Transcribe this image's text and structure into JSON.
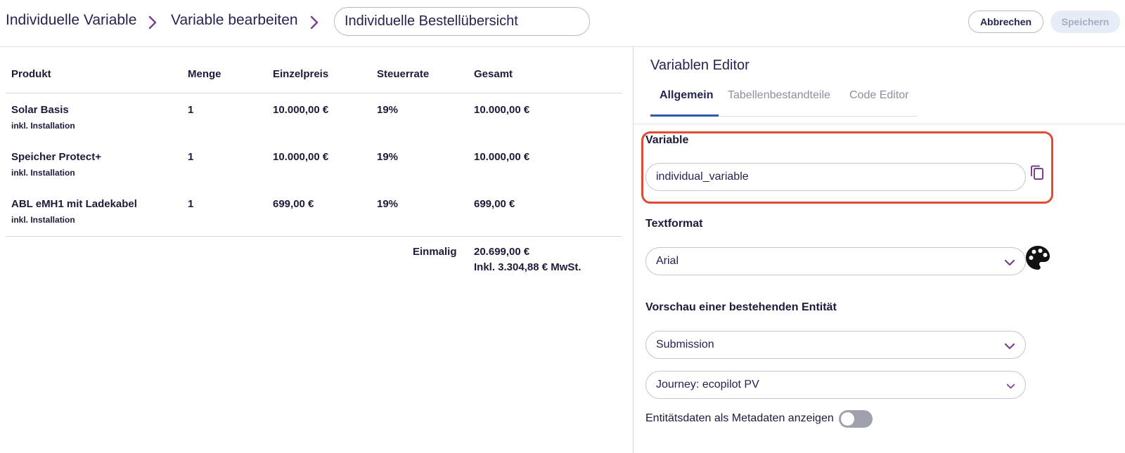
{
  "header": {
    "breadcrumb_1": "Individuelle Variable",
    "breadcrumb_2": "Variable bearbeiten",
    "name_value": "Individuelle Bestellübersicht",
    "cancel_label": "Abbrechen",
    "save_label": "Speichern"
  },
  "table": {
    "headers": [
      "Produkt",
      "Menge",
      "Einzelpreis",
      "Steuerrate",
      "Gesamt"
    ],
    "rows": [
      {
        "product": "Solar Basis",
        "note": "inkl. Installation",
        "qty": "1",
        "unit_price": "10.000,00 €",
        "tax": "19%",
        "total": "10.000,00 €"
      },
      {
        "product": "Speicher Protect+",
        "note": "inkl. Installation",
        "qty": "1",
        "unit_price": "10.000,00 €",
        "tax": "19%",
        "total": "10.000,00 €"
      },
      {
        "product": "ABL eMH1 mit Ladekabel",
        "note": "inkl. Installation",
        "qty": "1",
        "unit_price": "699,00 €",
        "tax": "19%",
        "total": "699,00 €"
      }
    ],
    "summary": {
      "label": "Einmalig",
      "total": "20.699,00 €",
      "vat_note": "Inkl. 3.304,88 € MwSt."
    }
  },
  "editor": {
    "title": "Variablen Editor",
    "tabs": [
      "Allgemein",
      "Tabellenbestandteile",
      "Code Editor"
    ],
    "active_tab": "Allgemein",
    "variable_label": "Variable",
    "variable_value": "individual_variable",
    "textformat_label": "Textformat",
    "textformat_value": "Arial",
    "preview_label": "Vorschau einer bestehenden Entität",
    "entity_value": "Submission",
    "journey_value": "Journey: ecopilot PV",
    "metadata_toggle_label": "Entitätsdaten als Metadaten anzeigen",
    "metadata_toggle_on": false
  },
  "colors": {
    "accent_purple": "#7a3f8f",
    "highlight_red": "#e04b34",
    "tab_active_blue": "#2a5ca8",
    "text_dark": "#1b1c3a"
  },
  "icons": [
    "chevron-right-icon",
    "copy-icon",
    "palette-icon",
    "chevron-down-icon"
  ]
}
